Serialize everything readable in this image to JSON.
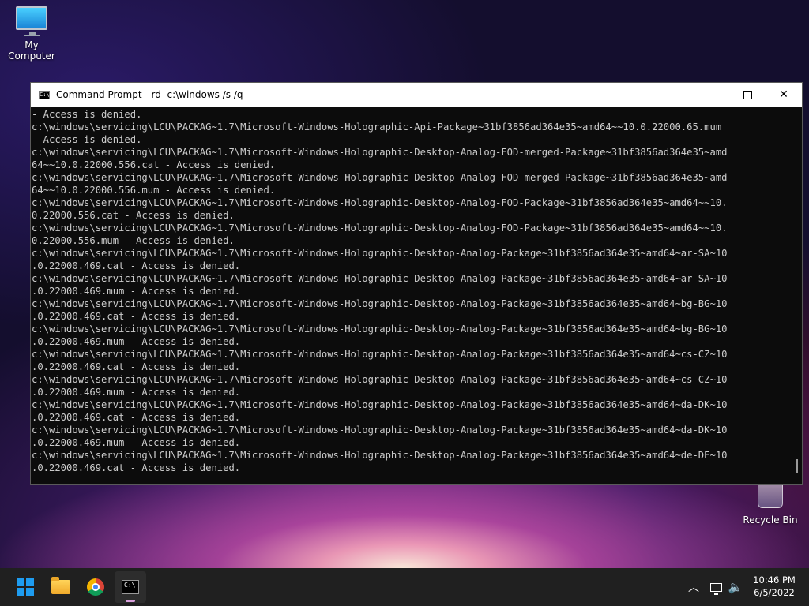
{
  "desktop": {
    "icons": [
      {
        "label": "My Computer",
        "icon": "computer-icon"
      },
      {
        "label": "Recycle Bin",
        "icon": "recycle-bin-icon"
      }
    ]
  },
  "window": {
    "title": "Command Prompt - rd  c:\\windows /s /q",
    "icon": "cmd-icon",
    "buttons": {
      "minimize": "minimize-icon",
      "maximize": "maximize-icon",
      "close": "close-icon"
    },
    "lines": [
      "- Access is denied.",
      "c:\\windows\\servicing\\LCU\\PACKAG~1.7\\Microsoft-Windows-Holographic-Api-Package~31bf3856ad364e35~amd64~~10.0.22000.65.mum",
      "- Access is denied.",
      "c:\\windows\\servicing\\LCU\\PACKAG~1.7\\Microsoft-Windows-Holographic-Desktop-Analog-FOD-merged-Package~31bf3856ad364e35~amd",
      "64~~10.0.22000.556.cat - Access is denied.",
      "c:\\windows\\servicing\\LCU\\PACKAG~1.7\\Microsoft-Windows-Holographic-Desktop-Analog-FOD-merged-Package~31bf3856ad364e35~amd",
      "64~~10.0.22000.556.mum - Access is denied.",
      "c:\\windows\\servicing\\LCU\\PACKAG~1.7\\Microsoft-Windows-Holographic-Desktop-Analog-FOD-Package~31bf3856ad364e35~amd64~~10.",
      "0.22000.556.cat - Access is denied.",
      "c:\\windows\\servicing\\LCU\\PACKAG~1.7\\Microsoft-Windows-Holographic-Desktop-Analog-FOD-Package~31bf3856ad364e35~amd64~~10.",
      "0.22000.556.mum - Access is denied.",
      "c:\\windows\\servicing\\LCU\\PACKAG~1.7\\Microsoft-Windows-Holographic-Desktop-Analog-Package~31bf3856ad364e35~amd64~ar-SA~10",
      ".0.22000.469.cat - Access is denied.",
      "c:\\windows\\servicing\\LCU\\PACKAG~1.7\\Microsoft-Windows-Holographic-Desktop-Analog-Package~31bf3856ad364e35~amd64~ar-SA~10",
      ".0.22000.469.mum - Access is denied.",
      "c:\\windows\\servicing\\LCU\\PACKAG~1.7\\Microsoft-Windows-Holographic-Desktop-Analog-Package~31bf3856ad364e35~amd64~bg-BG~10",
      ".0.22000.469.cat - Access is denied.",
      "c:\\windows\\servicing\\LCU\\PACKAG~1.7\\Microsoft-Windows-Holographic-Desktop-Analog-Package~31bf3856ad364e35~amd64~bg-BG~10",
      ".0.22000.469.mum - Access is denied.",
      "c:\\windows\\servicing\\LCU\\PACKAG~1.7\\Microsoft-Windows-Holographic-Desktop-Analog-Package~31bf3856ad364e35~amd64~cs-CZ~10",
      ".0.22000.469.cat - Access is denied.",
      "c:\\windows\\servicing\\LCU\\PACKAG~1.7\\Microsoft-Windows-Holographic-Desktop-Analog-Package~31bf3856ad364e35~amd64~cs-CZ~10",
      ".0.22000.469.mum - Access is denied.",
      "c:\\windows\\servicing\\LCU\\PACKAG~1.7\\Microsoft-Windows-Holographic-Desktop-Analog-Package~31bf3856ad364e35~amd64~da-DK~10",
      ".0.22000.469.cat - Access is denied.",
      "c:\\windows\\servicing\\LCU\\PACKAG~1.7\\Microsoft-Windows-Holographic-Desktop-Analog-Package~31bf3856ad364e35~amd64~da-DK~10",
      ".0.22000.469.mum - Access is denied.",
      "c:\\windows\\servicing\\LCU\\PACKAG~1.7\\Microsoft-Windows-Holographic-Desktop-Analog-Package~31bf3856ad364e35~amd64~de-DE~10",
      ".0.22000.469.cat - Access is denied."
    ]
  },
  "taskbar": {
    "apps": [
      {
        "name": "Start",
        "icon": "windows-logo-icon"
      },
      {
        "name": "File Explorer",
        "icon": "folder-icon"
      },
      {
        "name": "Google Chrome",
        "icon": "chrome-icon"
      },
      {
        "name": "Command Prompt",
        "icon": "cmd-icon",
        "active": true
      }
    ],
    "tray": {
      "chevron": "chevron-up-icon",
      "network": "network-icon",
      "volume": "volume-icon"
    },
    "time": "10:46 PM",
    "date": "6/5/2022"
  },
  "colors": {
    "console_bg": "#0c0c0c",
    "console_text": "#cccccc",
    "taskbar_bg": "#202020",
    "accent": "#1e9cf0"
  }
}
